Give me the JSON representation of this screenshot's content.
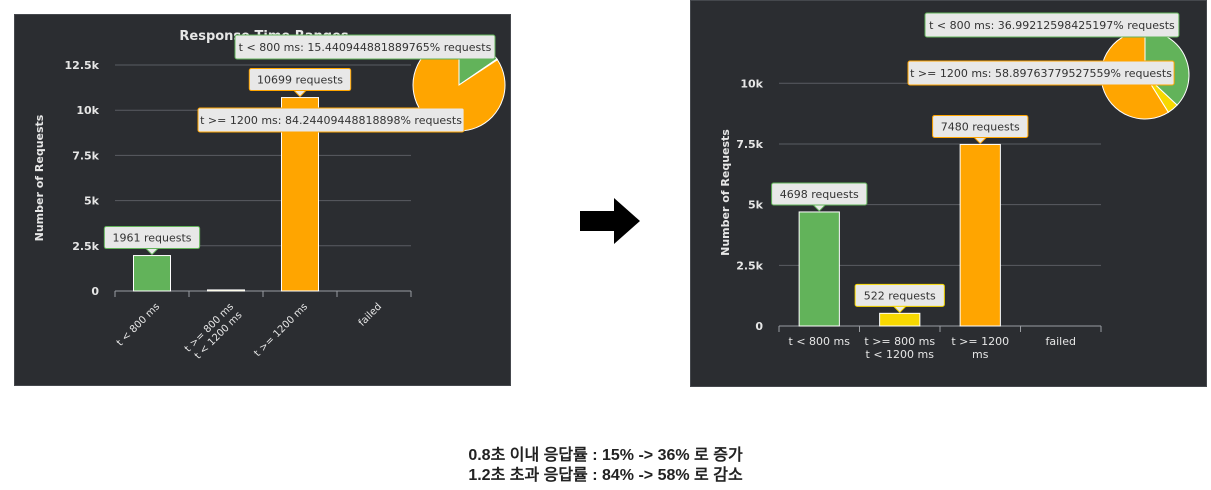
{
  "colors": {
    "green": "#62b35a",
    "yellow": "#f7d800",
    "orange": "#ffa500",
    "background": "#2b2d31",
    "grid": "#5a5d62",
    "text": "#e6e6e6"
  },
  "arrow_icon": "right-arrow-icon",
  "captions": [
    "0.8초 이내 응답률 : 15% -> 36% 로 증가",
    "1.2초 초과 응답률 : 84% -> 58% 로 감소"
  ],
  "chart_data": [
    {
      "type": "bar",
      "title": "Response Time Ranges",
      "ylabel": "Number of Requests",
      "ylim": [
        0,
        12500
      ],
      "yticks": [
        "0",
        "2.5k",
        "5k",
        "7.5k",
        "10k",
        "12.5k"
      ],
      "categories": [
        "t < 800 ms",
        "t >= 800 ms t < 1200 ms",
        "t >= 1200 ms",
        "failed"
      ],
      "category_lines": [
        [
          "t < 800 ms"
        ],
        [
          "t >= 800 ms",
          "t < 1200 ms"
        ],
        [
          "t >= 1200 ms"
        ],
        [
          "failed"
        ]
      ],
      "values": [
        1961,
        60,
        10699,
        0
      ],
      "bar_colors": [
        "#62b35a",
        "#f7d800",
        "#ffa500",
        "#ff0000"
      ],
      "bar_tooltips": [
        "1961 requests",
        "",
        "10699 requests",
        ""
      ],
      "pie": {
        "slices": [
          {
            "label": "t < 800 ms",
            "percent": 15.440944881889765,
            "color": "#62b35a"
          },
          {
            "label": "t >= 800 ms t < 1200 ms",
            "percent": 0.31496062992125984,
            "color": "#f7d800"
          },
          {
            "label": "t >= 1200 ms",
            "percent": 84.24409448818898,
            "color": "#ffa500"
          }
        ],
        "tooltips": [
          {
            "text": "t < 800 ms: 15.440944881889765% requests",
            "color": "#62b35a"
          },
          {
            "text": "t >= 1200 ms: 84.24409448818898% requests",
            "color": "#ffa500"
          }
        ]
      }
    },
    {
      "type": "bar",
      "title": "",
      "ylabel": "Number of Requests",
      "ylim": [
        0,
        11000
      ],
      "yticks": [
        "0",
        "2.5k",
        "5k",
        "7.5k",
        "10k"
      ],
      "categories": [
        "t < 800 ms",
        "t >= 800 ms t < 1200 ms",
        "t >= 1200 ms",
        "failed"
      ],
      "category_lines": [
        [
          "t < 800 ms"
        ],
        [
          "t >= 800 ms",
          "t < 1200 ms"
        ],
        [
          "t >= 1200",
          "ms"
        ],
        [
          "failed"
        ]
      ],
      "values": [
        4698,
        522,
        7480,
        0
      ],
      "bar_colors": [
        "#62b35a",
        "#f7d800",
        "#ffa500",
        "#ff0000"
      ],
      "bar_tooltips": [
        "4698 requests",
        "522 requests",
        "7480 requests",
        ""
      ],
      "pie": {
        "slices": [
          {
            "label": "t < 800 ms",
            "percent": 36.99212598425197,
            "color": "#62b35a"
          },
          {
            "label": "t >= 800 ms t < 1200 ms",
            "percent": 4.11,
            "color": "#f7d800"
          },
          {
            "label": "t >= 1200 ms",
            "percent": 58.89763779527559,
            "color": "#ffa500"
          }
        ],
        "tooltips": [
          {
            "text": "t < 800 ms: 36.99212598425197% requests",
            "color": "#62b35a"
          },
          {
            "text": "t >= 1200 ms: 58.89763779527559% requests",
            "color": "#ffa500"
          }
        ]
      }
    }
  ]
}
